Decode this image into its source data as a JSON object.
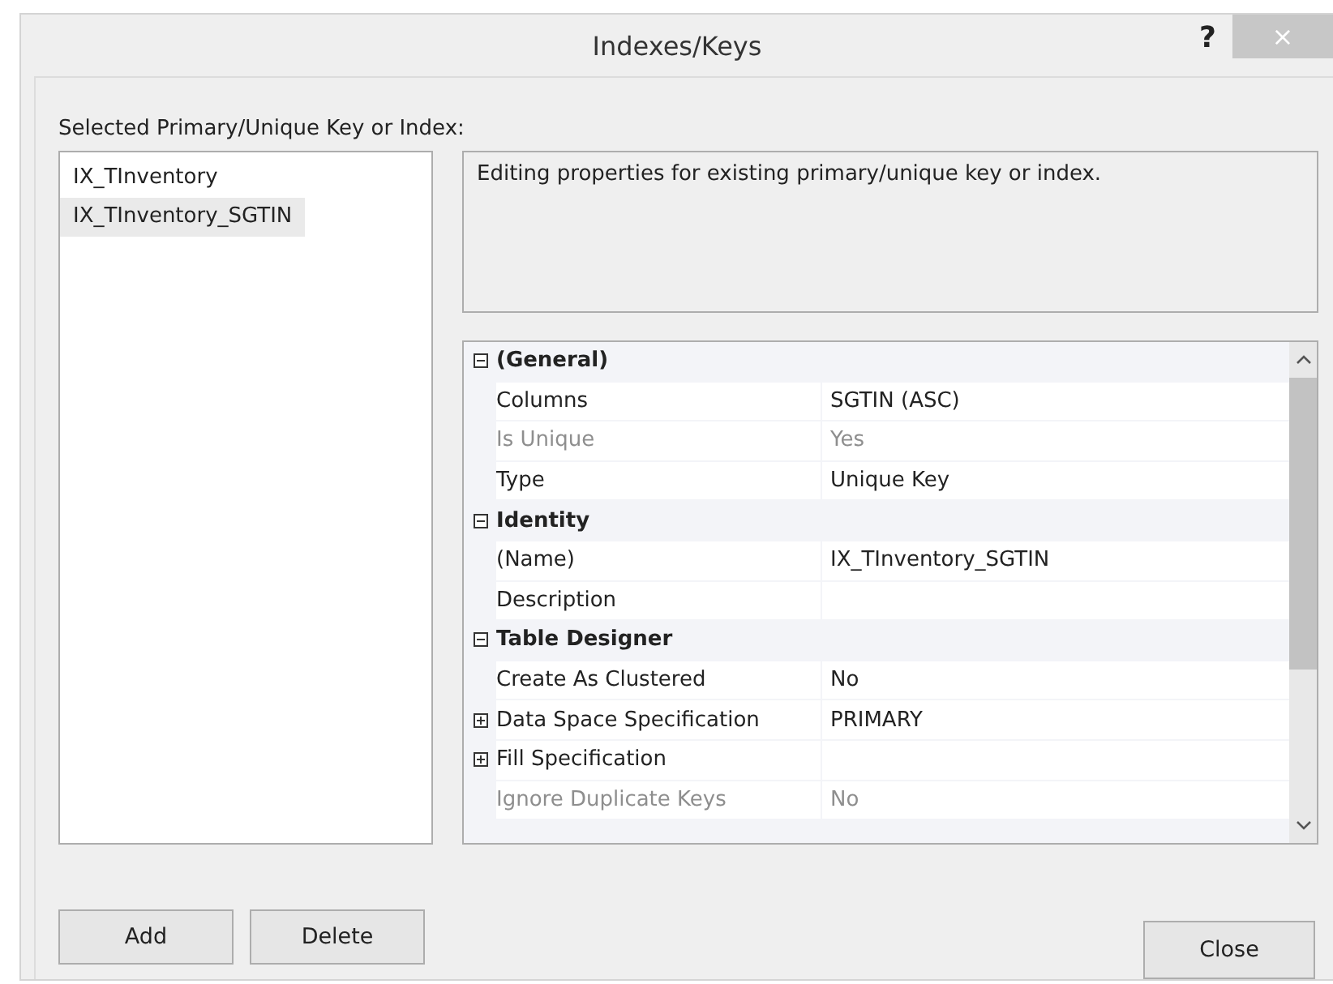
{
  "window": {
    "title": "Indexes/Keys",
    "help": "?",
    "close": "×"
  },
  "list_label": "Selected Primary/Unique Key or Index:",
  "index_list": [
    {
      "label": "IX_TInventory",
      "selected": false
    },
    {
      "label": "IX_TInventory_SGTIN",
      "selected": true
    }
  ],
  "description": "Editing properties for existing primary/unique key or index.",
  "properties": [
    {
      "kind": "category",
      "name": "(General)",
      "expanded": true
    },
    {
      "kind": "property",
      "name": "Columns",
      "value": "SGTIN (ASC)",
      "disabled": false
    },
    {
      "kind": "property",
      "name": "Is Unique",
      "value": "Yes",
      "disabled": true
    },
    {
      "kind": "property",
      "name": "Type",
      "value": "Unique Key",
      "disabled": false
    },
    {
      "kind": "category",
      "name": "Identity",
      "expanded": true
    },
    {
      "kind": "property",
      "name": "(Name)",
      "value": "IX_TInventory_SGTIN",
      "disabled": false
    },
    {
      "kind": "property",
      "name": "Description",
      "disabled": false
    },
    {
      "kind": "category",
      "name": "Table Designer",
      "expanded": true
    },
    {
      "kind": "property",
      "name": "Create As Clustered",
      "value": "No",
      "disabled": false
    },
    {
      "kind": "property",
      "name": "Data Space Specification",
      "value": "PRIMARY",
      "disabled": false,
      "expanded": false
    },
    {
      "kind": "property",
      "name": "Fill Specification",
      "disabled": false,
      "expanded": false
    },
    {
      "kind": "property",
      "name": "Ignore Duplicate Keys",
      "value": "No",
      "disabled": true
    }
  ],
  "buttons": {
    "add": "Add",
    "delete": "Delete",
    "close": "Close"
  }
}
